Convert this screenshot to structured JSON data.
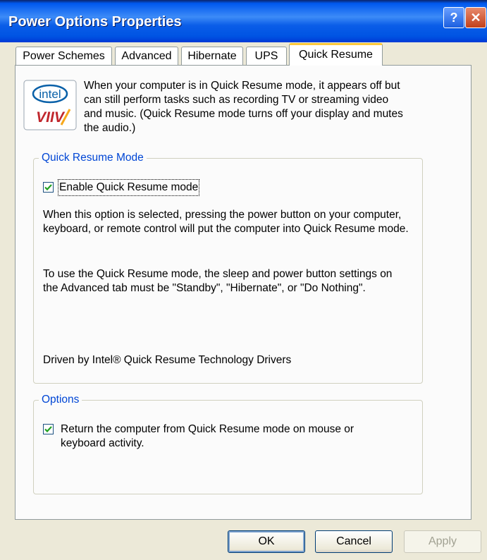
{
  "window": {
    "title": "Power Options Properties",
    "help_label": "?",
    "close_label": "✕"
  },
  "tabs": [
    {
      "label": "Power Schemes",
      "active": false
    },
    {
      "label": "Advanced",
      "active": false
    },
    {
      "label": "Hibernate",
      "active": false
    },
    {
      "label": "UPS",
      "active": false
    },
    {
      "label": "Quick Resume",
      "active": true
    }
  ],
  "logo": {
    "top_text": "intel",
    "bottom_text": "VIIV",
    "icon": "intel-viiv-logo"
  },
  "intro_text": "When your computer is in Quick Resume mode, it appears off but can still perform tasks such as recording TV or streaming video and music. (Quick Resume mode turns off your display and mutes the audio.)",
  "quick_resume_group": {
    "legend": "Quick Resume Mode",
    "enable_checkbox": {
      "label": "Enable Quick Resume mode",
      "checked": true
    },
    "description": "When this option is selected, pressing the power button on your computer, keyboard, or remote control will put the computer into Quick Resume mode.",
    "usage_note": "To use the Quick Resume mode, the sleep and power button settings on the Advanced tab must be \"Standby\", \"Hibernate\", or \"Do Nothing\".",
    "driver_text": "Driven by Intel® Quick Resume Technology Drivers"
  },
  "options_group": {
    "legend": "Options",
    "return_checkbox": {
      "label": "Return the computer from Quick Resume mode on mouse or keyboard activity.",
      "checked": true
    }
  },
  "buttons": {
    "ok": "OK",
    "cancel": "Cancel",
    "apply": "Apply"
  },
  "colors": {
    "titlebar": "#0054e3",
    "legend_text": "#0046d5",
    "active_tab_highlight": "#ffc83c",
    "checkmark": "#21a121"
  }
}
